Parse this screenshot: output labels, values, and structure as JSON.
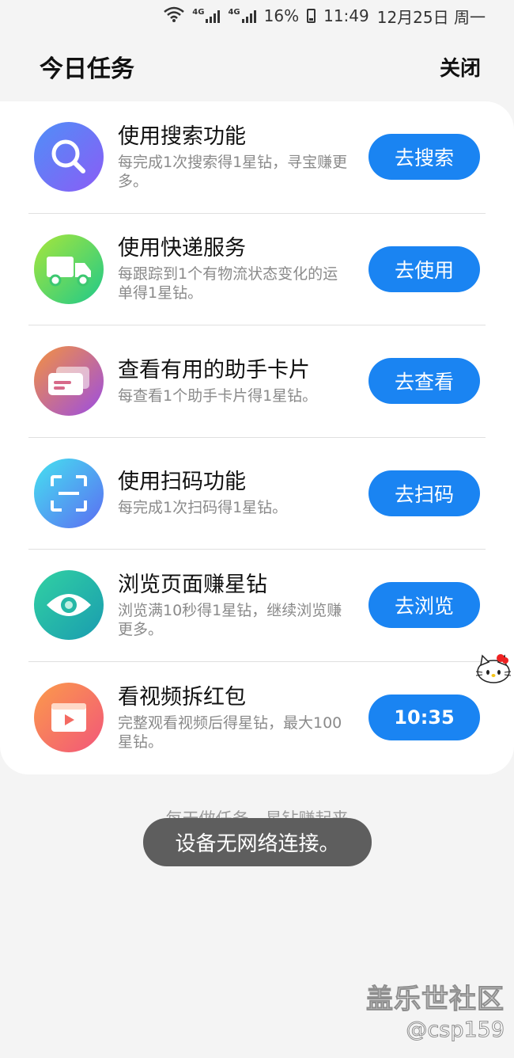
{
  "status_bar": {
    "network_a": "4G",
    "network_b": "4G",
    "battery": "16%",
    "time": "11:49",
    "date": "12月25日 周一"
  },
  "header": {
    "title": "今日任务",
    "close_label": "关闭"
  },
  "tasks": [
    {
      "icon": "search-icon",
      "title": "使用搜索功能",
      "desc": "每完成1次搜索得1星钻，寻宝赚更多。",
      "button": "去搜索"
    },
    {
      "icon": "truck-icon",
      "title": "使用快递服务",
      "desc": "每跟踪到1个有物流状态变化的运单得1星钻。",
      "button": "去使用"
    },
    {
      "icon": "cards-icon",
      "title": "查看有用的助手卡片",
      "desc": "每查看1个助手卡片得1星钻。",
      "button": "去查看"
    },
    {
      "icon": "scan-icon",
      "title": "使用扫码功能",
      "desc": "每完成1次扫码得1星钻。",
      "button": "去扫码"
    },
    {
      "icon": "eye-icon",
      "title": "浏览页面赚星钻",
      "desc": "浏览满10秒得1星钻，继续浏览赚更多。",
      "button": "去浏览"
    },
    {
      "icon": "video-icon",
      "title": "看视频拆红包",
      "desc": "完整观看视频后得星钻，最大100星钻。",
      "button": "10:35"
    }
  ],
  "footer_hint": "每天做任务，星钻赚起来",
  "toast": "设备无网络连接。",
  "watermark": {
    "title": "盖乐世社区",
    "handle": "@csp159"
  },
  "colors": {
    "accent": "#1a84f2",
    "background": "#f4f4f4",
    "card": "#ffffff",
    "toast": "#5e5e5e"
  }
}
